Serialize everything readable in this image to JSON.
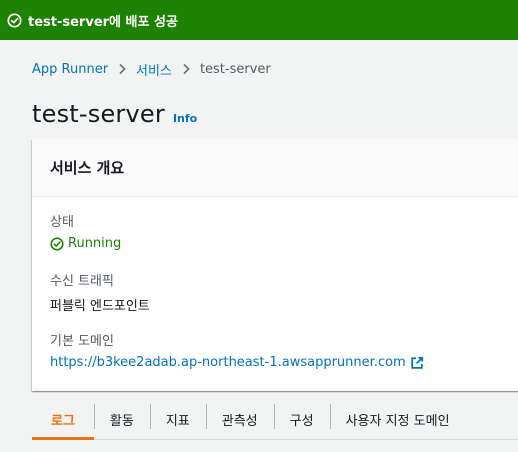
{
  "flash": {
    "message": "test-server에 배포 성공",
    "color": "#1d8102",
    "icon": "check-circle-icon"
  },
  "breadcrumb": {
    "items": [
      "App Runner",
      "서비스",
      "test-server"
    ],
    "separator_icon": "chevron-right-icon"
  },
  "header": {
    "title": "test-server",
    "info_label": "Info"
  },
  "overview": {
    "title": "서비스 개요",
    "status_label": "상태",
    "status_value": "Running",
    "status_icon": "check-circle-icon",
    "status_color": "#1d8102",
    "traffic_label": "수신 트래픽",
    "traffic_value": "퍼블릭 엔드포인트",
    "domain_label": "기본 도메인",
    "domain_value": "https://b3kee2adab.ap-northeast-1.awsapprunner.com",
    "domain_icon": "external-link-icon"
  },
  "tabs": [
    {
      "label": "로그",
      "active": true
    },
    {
      "label": "활동",
      "active": false
    },
    {
      "label": "지표",
      "active": false
    },
    {
      "label": "관측성",
      "active": false
    },
    {
      "label": "구성",
      "active": false
    },
    {
      "label": "사용자 지정 도메인",
      "active": false
    }
  ],
  "colors": {
    "link": "#0073bb",
    "active_tab": "#ec7211"
  }
}
